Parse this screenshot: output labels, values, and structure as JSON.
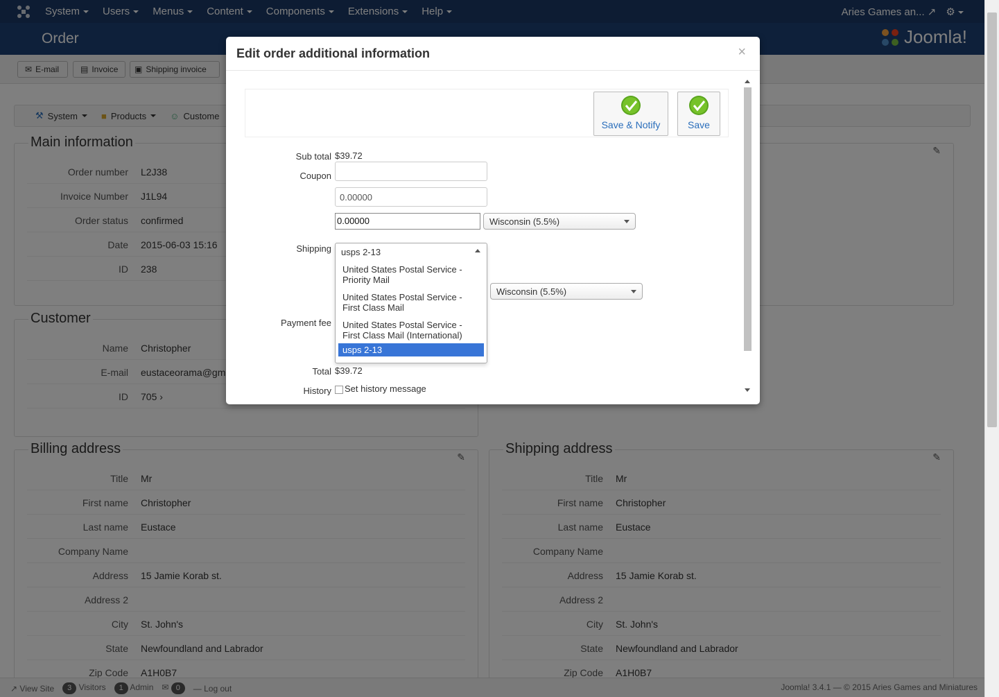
{
  "topbar": {
    "menu": [
      "System",
      "Users",
      "Menus",
      "Content",
      "Components",
      "Extensions",
      "Help"
    ],
    "site_name": "Aries Games an...",
    "brand_color": "#1a3867"
  },
  "header": {
    "title": "Order",
    "logo_text": "Joomla!"
  },
  "toolbar": {
    "email": "E-mail",
    "invoice": "Invoice",
    "shipping_invoice": "Shipping invoice"
  },
  "subnav": {
    "items": [
      "System",
      "Products",
      "Custome"
    ]
  },
  "main_information": {
    "title": "Main information",
    "rows": [
      {
        "label": "Order number",
        "value": "L2J38"
      },
      {
        "label": "Invoice Number",
        "value": "J1L94"
      },
      {
        "label": "Order status",
        "value": "confirmed"
      },
      {
        "label": "Date",
        "value": "2015-06-03 15:16"
      },
      {
        "label": "ID",
        "value": "238"
      }
    ]
  },
  "customer": {
    "title": "Customer",
    "rows": [
      {
        "label": "Name",
        "value": "Christopher"
      },
      {
        "label": "E-mail",
        "value": "eustaceorama@gmai"
      },
      {
        "label": "ID",
        "value": "705"
      }
    ]
  },
  "billing_address": {
    "title": "Billing address",
    "rows": [
      {
        "label": "Title",
        "value": "Mr"
      },
      {
        "label": "First name",
        "value": "Christopher"
      },
      {
        "label": "Last name",
        "value": "Eustace"
      },
      {
        "label": "Company Name",
        "value": ""
      },
      {
        "label": "Address",
        "value": "15 Jamie Korab st."
      },
      {
        "label": "Address 2",
        "value": ""
      },
      {
        "label": "City",
        "value": "St. John's"
      },
      {
        "label": "State",
        "value": "Newfoundland and Labrador"
      },
      {
        "label": "Zip Code",
        "value": "A1H0B7"
      }
    ]
  },
  "shipping_address": {
    "title": "Shipping address",
    "rows": [
      {
        "label": "Title",
        "value": "Mr"
      },
      {
        "label": "First name",
        "value": "Christopher"
      },
      {
        "label": "Last name",
        "value": "Eustace"
      },
      {
        "label": "Company Name",
        "value": ""
      },
      {
        "label": "Address",
        "value": "15 Jamie Korab st."
      },
      {
        "label": "Address 2",
        "value": ""
      },
      {
        "label": "City",
        "value": "St. John's"
      },
      {
        "label": "State",
        "value": "Newfoundland and Labrador"
      },
      {
        "label": "Zip Code",
        "value": "A1H0B7"
      }
    ]
  },
  "modal": {
    "title": "Edit order additional information",
    "close": "×",
    "save_notify": "Save & Notify",
    "save": "Save",
    "subtotal_label": "Sub total",
    "subtotal_value": "$39.72",
    "coupon_label": "Coupon",
    "coupon_value": "",
    "discount_value": "0.00000",
    "tax_value": "0.00000",
    "tax_region": "Wisconsin (5.5%)",
    "shipping_label": "Shipping",
    "shipping_selected": "usps 2-13",
    "shipping_options": [
      "United States Postal Service - Priority Mail",
      "United States Postal Service - First Class Mail",
      "United States Postal Service - First Class Mail (International)",
      "usps 2-13"
    ],
    "shipping_tax_region": "Wisconsin (5.5%)",
    "payment_fee_label": "Payment fee",
    "total_label": "Total",
    "total_value": "$39.72",
    "history_label": "History",
    "history_checkbox": "Set history message"
  },
  "statusbar": {
    "view_site": "View Site",
    "visitors_count": "3",
    "visitors": "Visitors",
    "admin_count": "1",
    "admin": "Admin",
    "messages_count": "0",
    "logout": "Log out",
    "footer": "Joomla! 3.4.1 — © 2015 Aries Games and Miniatures"
  }
}
